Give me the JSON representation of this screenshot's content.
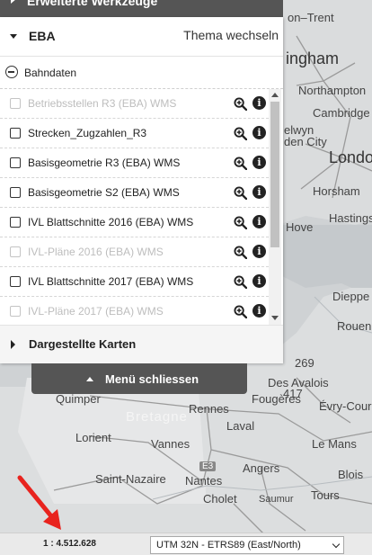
{
  "header": {
    "title": "Erweiterte Werkzeuge"
  },
  "theme": {
    "name": "EBA",
    "switch_label": "Thema wechseln"
  },
  "group": {
    "name": "Bahndaten"
  },
  "layers": [
    {
      "name": "Betriebsstellen R3 (EBA) WMS",
      "enabled": false
    },
    {
      "name": "Strecken_Zugzahlen_R3",
      "enabled": true
    },
    {
      "name": "Basisgeometrie R3 (EBA) WMS",
      "enabled": true
    },
    {
      "name": "Basisgeometrie S2 (EBA) WMS",
      "enabled": true
    },
    {
      "name": "IVL Blattschnitte 2016 (EBA) WMS",
      "enabled": true
    },
    {
      "name": "IVL-Pläne 2016 (EBA) WMS",
      "enabled": false
    },
    {
      "name": "IVL Blattschnitte 2017 (EBA) WMS",
      "enabled": true
    },
    {
      "name": "IVL-Pläne 2017 (EBA) WMS",
      "enabled": false
    }
  ],
  "maps_section": {
    "label": "Dargestellte Karten"
  },
  "close_menu": {
    "label": "Menü schliessen"
  },
  "footer": {
    "scale": "1 : 4.512.628",
    "crs_selected": "UTM 32N - ETRS89 (East/North)"
  },
  "map_labels": {
    "trent": "on–Trent",
    "nottingham": "ingham",
    "northampton": "Northampton",
    "cambridge": "Cambridge",
    "elwyn": "elwyn",
    "den_city": "den City",
    "london": "Londo",
    "horsham": "Horsham",
    "hastings": "Hastings",
    "hove": "Hove",
    "dieppe": "Dieppe",
    "rouen": "Rouen",
    "n269": "269",
    "avalois": "Des Avalois",
    "a417": "417",
    "fougeres": "Fougères",
    "evry": "Évry-Cour",
    "quimper": "Quimper",
    "bretagne": "Bretagne",
    "rennes": "Rennes",
    "laval": "Laval",
    "lorient": "Lorient",
    "vannes": "Vannes",
    "le_mans": "Le Mans",
    "e3": "E3",
    "saint_nazaire": "Saint-Nazaire",
    "angers": "Angers",
    "nantes": "Nantes",
    "blois": "Blois",
    "cholet": "Cholet",
    "saumur": "Saumur",
    "tours": "Tours"
  },
  "colors": {
    "panel_header": "#555555",
    "annotation": "#e8231e"
  }
}
